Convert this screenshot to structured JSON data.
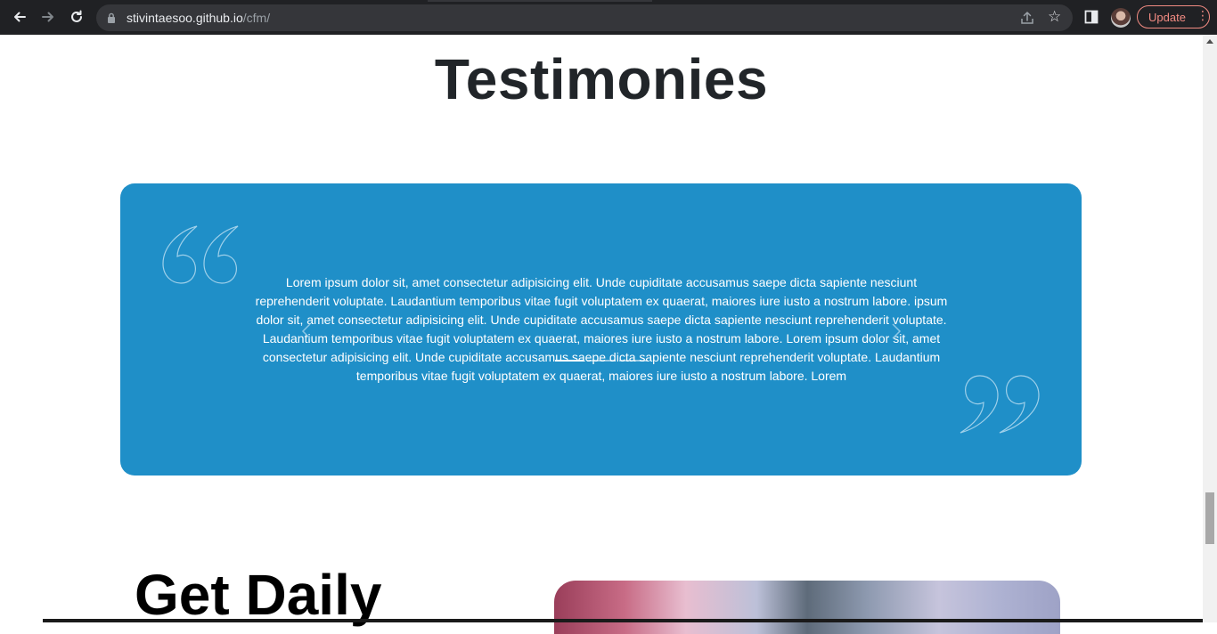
{
  "browser": {
    "url_host": "stivintaesoo.github.io",
    "url_path": "/cfm/",
    "update_label": "Update",
    "menu_glyph": "⋮",
    "icons": [
      "back-icon",
      "forward-icon",
      "reload-icon",
      "lock-icon",
      "share-icon",
      "star-icon",
      "side-panel-icon",
      "profile-avatar",
      "menu-icon"
    ]
  },
  "testimonies": {
    "title": "Testimonies",
    "quote": "Lorem ipsum dolor sit, amet consectetur adipisicing elit. Unde cupiditate accusamus saepe dicta sapiente nesciunt reprehenderit voluptate. Laudantium temporibus vitae fugit voluptatem ex quaerat, maiores iure iusto a nostrum labore. ipsum dolor sit, amet consectetur adipisicing elit. Unde cupiditate accusamus saepe dicta sapiente nesciunt reprehenderit voluptate. Laudantium temporibus vitae fugit voluptatem ex quaerat, maiores iure iusto a nostrum labore. Lorem ipsum dolor sit, amet consectetur adipisicing elit. Unde cupiditate accusamus saepe dicta sapiente nesciunt reprehenderit voluptate. Laudantium temporibus vitae fugit voluptatem ex quaerat, maiores iure iusto a nostrum labore. Lorem",
    "card_color": "#1f8fc8",
    "carousel": {
      "slides": 3,
      "active_index": 0
    }
  },
  "next_section": {
    "title": "Get Daily"
  }
}
